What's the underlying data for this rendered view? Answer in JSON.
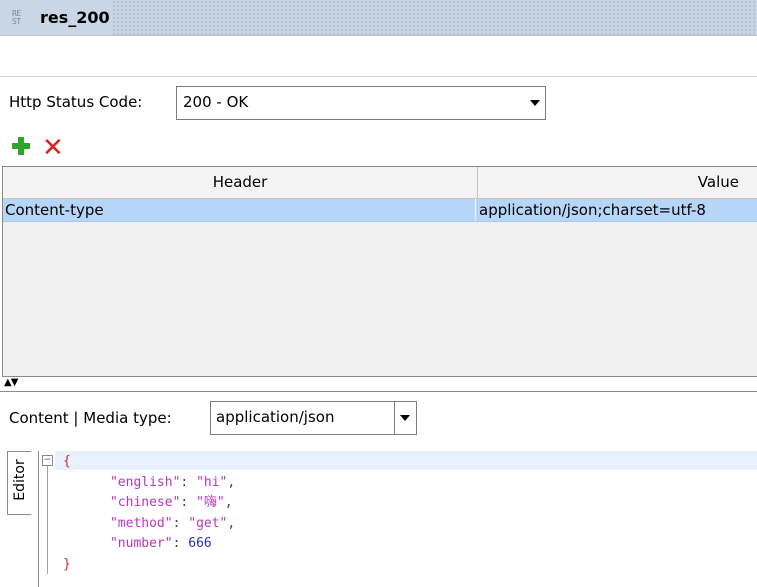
{
  "window": {
    "tab_title": "res_200",
    "tab_icon": "rest-icon",
    "tab_icon_text_top": "RE",
    "tab_icon_text_bottom": "ST"
  },
  "status": {
    "label": "Http Status Code:",
    "value": "200 - OK"
  },
  "toolbar": {
    "add_icon": "plus-icon",
    "delete_icon": "delete-x-icon"
  },
  "headers_table": {
    "columns": [
      "Header",
      "Value"
    ],
    "rows": [
      {
        "header": "Content-type",
        "value": "application/json;charset=utf-8"
      }
    ]
  },
  "content": {
    "label": "Content | Media type:",
    "media_type": "application/json"
  },
  "editor": {
    "tab_label": "Editor",
    "open_brace": "{",
    "close_brace": "}",
    "lines": [
      {
        "key": "\"english\"",
        "value": "\"hi\"",
        "trailing": ","
      },
      {
        "key": "\"chinese\"",
        "value": "\"嗨\"",
        "trailing": ","
      },
      {
        "key": "\"method\"",
        "value": "\"get\"",
        "trailing": ","
      },
      {
        "key": "\"number\"",
        "value": "666",
        "trailing": ""
      }
    ]
  },
  "colors": {
    "titlebar": "#c9d6e6",
    "selected_row": "#b6d6f7",
    "json_string": "#b838b8",
    "json_number": "#2b2bd8",
    "json_brace": "#d22e2e",
    "add_green": "#2fa52f",
    "delete_red": "#dd2222"
  }
}
